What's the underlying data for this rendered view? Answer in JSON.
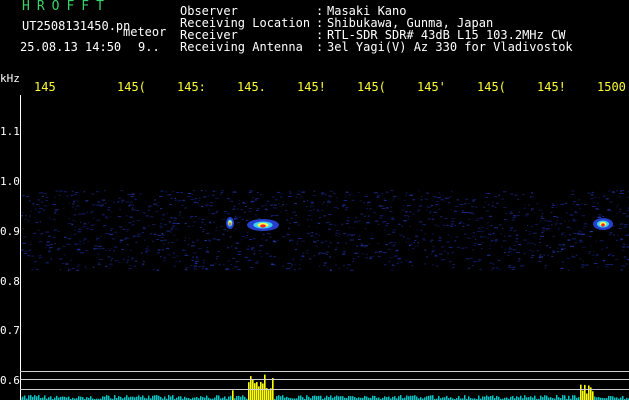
{
  "header": {
    "title": "HROFFT",
    "filename": "UT2508131450.pn",
    "tag": "meteor",
    "datetime": "25.08.13 14:50",
    "duration": "9..",
    "info": [
      {
        "label": "Observer",
        "sep": ":",
        "value": "Masaki Kano"
      },
      {
        "label": "Receiving Location",
        "sep": ":",
        "value": "Shibukawa, Gunma, Japan"
      },
      {
        "label": "Receiver",
        "sep": ":",
        "value": "RTL-SDR SDR# 43dB L15 103.2MHz CW"
      },
      {
        "label": "Receiving Antenna",
        "sep": ":",
        "value": "3el Yagi(V) Az 330 for Vladivostok"
      }
    ]
  },
  "axis": {
    "unit": "kHz",
    "freq_labels": [
      "145",
      "145(",
      "145:",
      "145.",
      "145!",
      "145(",
      "145'",
      "145(",
      "145!",
      "1500"
    ],
    "y_labels": [
      "1.1",
      "1.0",
      "0.9",
      "0.8",
      "0.7",
      "0.6"
    ]
  },
  "colors": {
    "title": "#37d36a",
    "freq_labels": "#ffff33",
    "echo_core": "#ff2020",
    "echo_halo": "#ffff40",
    "noise": "#1a2c9e",
    "power_bars": "#ffff00",
    "power_base": "#00c8c8"
  }
}
